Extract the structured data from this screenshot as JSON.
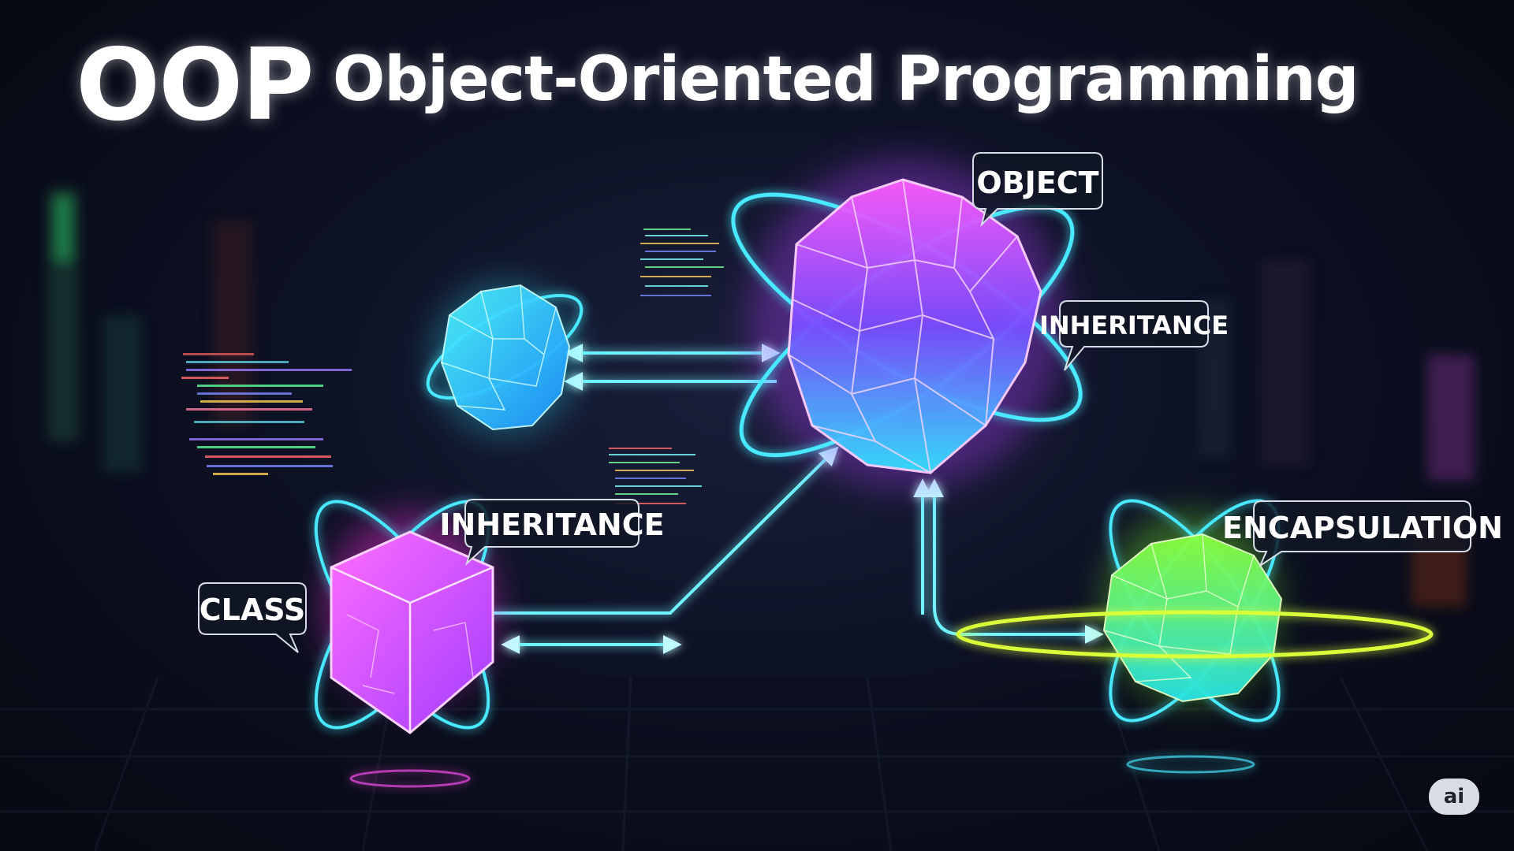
{
  "header": {
    "abbreviation": "OOP",
    "title": "Object-Oriented Programming"
  },
  "nodes": {
    "object": {
      "label": "OBJECT",
      "color": "#e040ff"
    },
    "inheritance_top": {
      "label": "INHERITANCE"
    },
    "inheritance_left": {
      "label": "INHERITANCE"
    },
    "class": {
      "label": "CLASS",
      "color": "#ff30e0"
    },
    "encapsulation": {
      "label": "ENCAPSULATION",
      "color": "#7cff2a"
    },
    "small_crystal": {
      "color": "#2ee6ff"
    }
  },
  "colors": {
    "connector": "#6ff3ff",
    "orbit_cyan": "#49e9ff",
    "orbit_yellow": "#d9ff3a"
  },
  "badge": {
    "text": "ai"
  }
}
